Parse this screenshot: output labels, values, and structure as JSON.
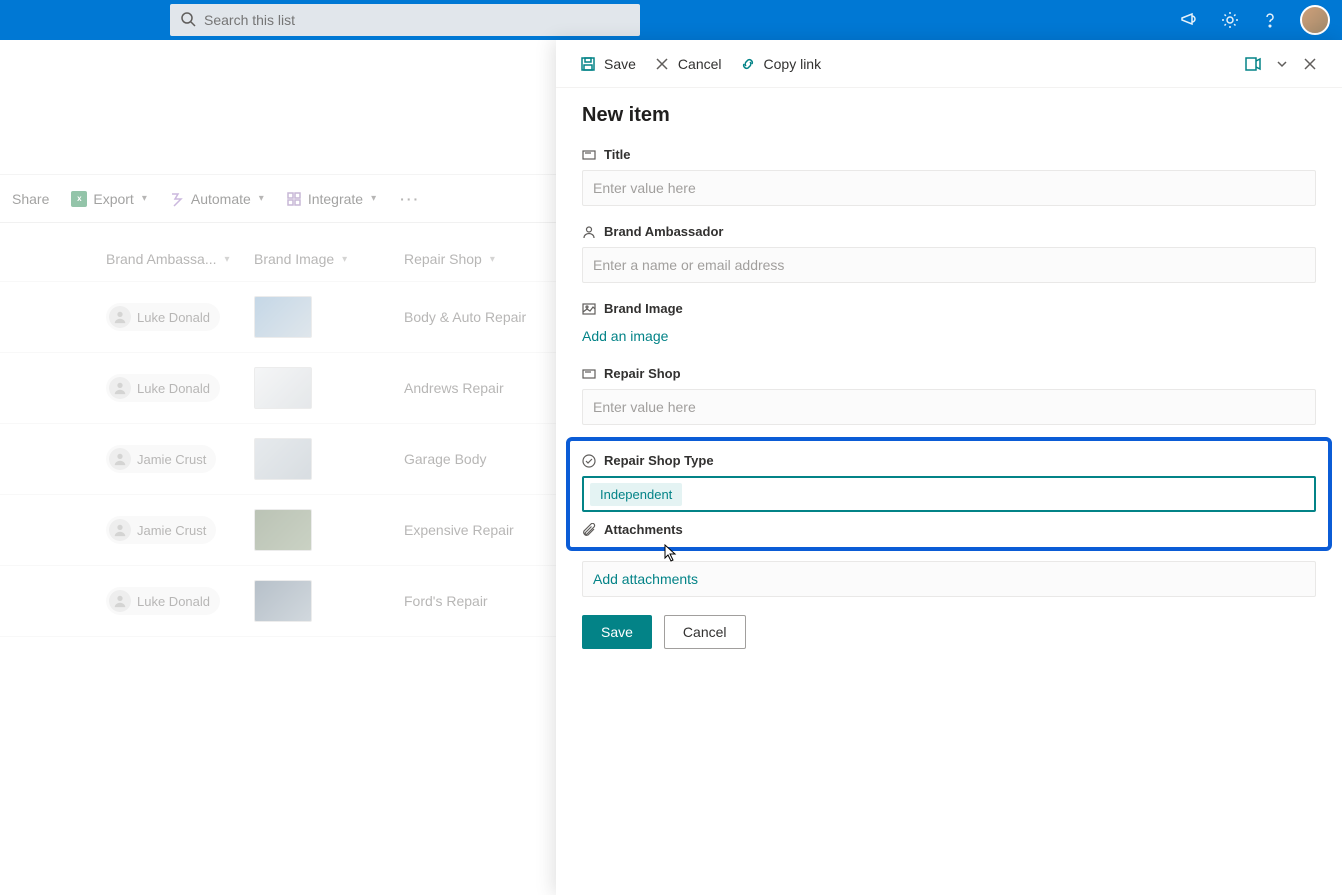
{
  "topbar": {
    "search_placeholder": "Search this list"
  },
  "cmdbar": {
    "share": "Share",
    "export": "Export",
    "automate": "Automate",
    "integrate": "Integrate"
  },
  "columns": {
    "ambassador": "Brand Ambassa...",
    "image": "Brand Image",
    "shop": "Repair Shop"
  },
  "rows": [
    {
      "ambassador": "Luke Donald",
      "shop": "Body & Auto Repair"
    },
    {
      "ambassador": "Luke Donald",
      "shop": "Andrews Repair"
    },
    {
      "ambassador": "Jamie Crust",
      "shop": "Garage Body"
    },
    {
      "ambassador": "Jamie Crust",
      "shop": "Expensive Repair"
    },
    {
      "ambassador": "Luke Donald",
      "shop": "Ford's Repair"
    }
  ],
  "panel": {
    "top": {
      "save": "Save",
      "cancel": "Cancel",
      "copylink": "Copy link"
    },
    "title": "New item",
    "fields": {
      "title_label": "Title",
      "title_placeholder": "Enter value here",
      "ambassador_label": "Brand Ambassador",
      "ambassador_placeholder": "Enter a name or email address",
      "image_label": "Brand Image",
      "image_action": "Add an image",
      "shop_label": "Repair Shop",
      "shop_placeholder": "Enter value here",
      "shoptype_label": "Repair Shop Type",
      "shoptype_value": "Independent",
      "attachments_label": "Attachments",
      "attachments_action": "Add attachments"
    },
    "buttons": {
      "save": "Save",
      "cancel": "Cancel"
    }
  }
}
